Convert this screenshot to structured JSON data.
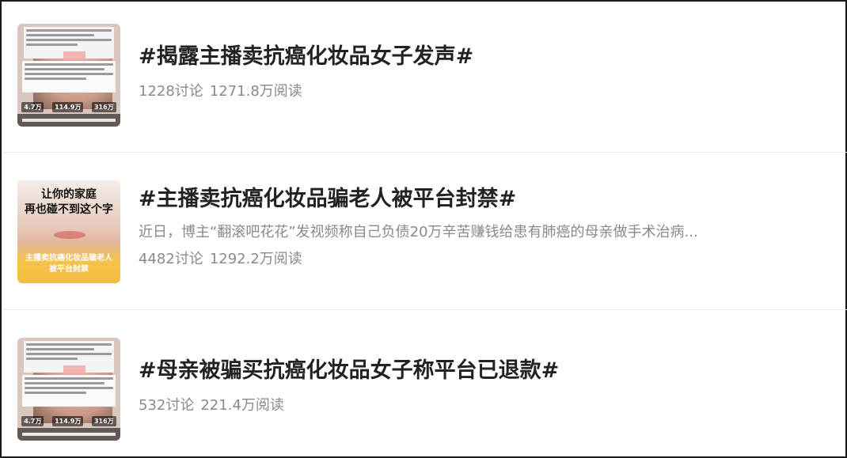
{
  "topics": [
    {
      "title": "#揭露主播卖抗癌化妆品女子发声#",
      "summary": "",
      "discussions": "1228讨论",
      "reads": "1271.8万阅读",
      "thumbnail": "video-screenshot"
    },
    {
      "title": "#主播卖抗癌化妆品骗老人被平台封禁#",
      "summary": "近日，博主“翻滚吧花花”发视频称自己负债20万辛苦赚钱给患有肺癌的母亲做手术治病...",
      "discussions": "4482讨论",
      "reads": "1292.2万阅读",
      "thumbnail": "poster",
      "thumbnail_text_top": "让你的家庭\n再也碰不到这个字",
      "thumbnail_text_bottom": "主播卖抗癌化妆品骗老人\n被平台封禁"
    },
    {
      "title": "#母亲被骗买抗癌化妆品女子称平台已退款#",
      "summary": "",
      "discussions": "532讨论",
      "reads": "221.4万阅读",
      "thumbnail": "video-screenshot"
    }
  ],
  "thumbnail_stats": [
    "4.7万",
    "114.9万",
    "316万"
  ],
  "colors": {
    "title": "#222222",
    "meta": "#8a8a8a",
    "poster_yellow": "#f4be3c",
    "divider": "#ececec"
  }
}
